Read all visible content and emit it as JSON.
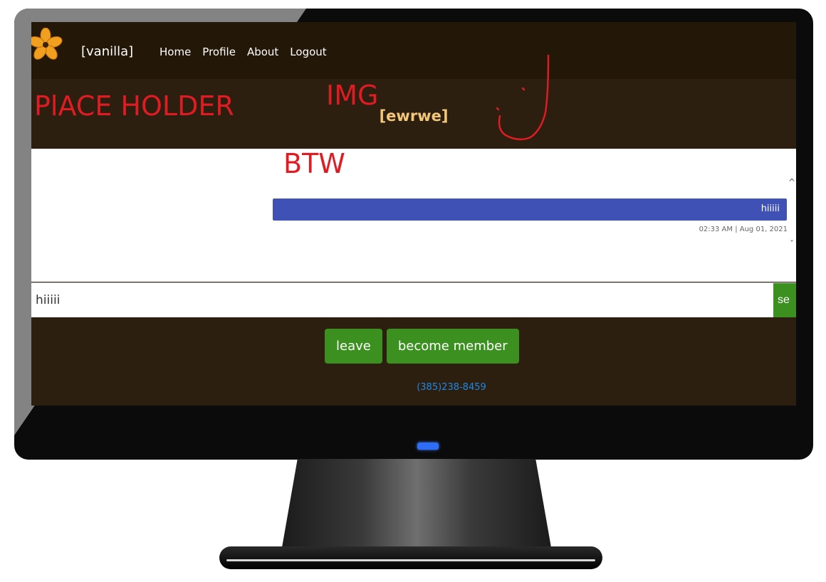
{
  "app": {
    "brand": "[vanilla]",
    "nav": [
      "Home",
      "Profile",
      "About",
      "Logout"
    ]
  },
  "room": {
    "title": "[ewrwe]"
  },
  "chat": {
    "messages": [
      {
        "text": "hiiiii",
        "time": "02:33 AM | Aug 01, 2021"
      }
    ]
  },
  "composer": {
    "value": "hiiiii",
    "send_label": "se"
  },
  "actions": {
    "leave": "leave",
    "become_member": "become member"
  },
  "footer": {
    "phone": "(385)238-8459"
  },
  "annotation": {
    "line1a": "PlACE HOLDER",
    "line1b": "IMG",
    "line2": "BTW"
  },
  "colors": {
    "nav_bg": "#231707",
    "page_bg": "#2c1f0f",
    "title": "#f3c77a",
    "button": "#3b9020",
    "message": "#3f51b5",
    "link": "#1e88e5",
    "annotation": "#e01b24"
  },
  "icons": {
    "logo": "flower-icon",
    "scroll_up": "chevron-up-icon",
    "scroll_down": "chevron-down-icon"
  }
}
